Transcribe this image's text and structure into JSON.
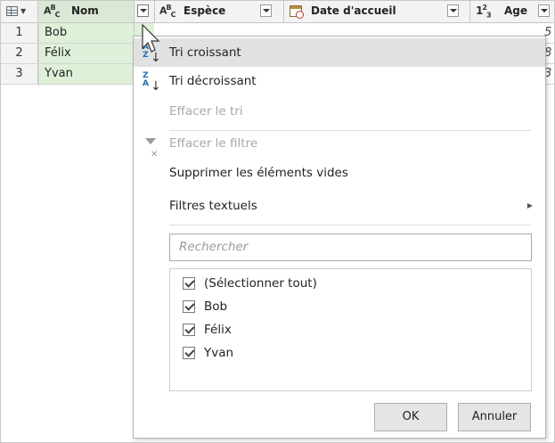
{
  "columns": [
    {
      "type_icon": "table-icon",
      "label": ""
    },
    {
      "type_icon": "abc-icon",
      "label": "Nom"
    },
    {
      "type_icon": "abc-icon",
      "label": "Espèce"
    },
    {
      "type_icon": "date-icon",
      "label": "Date d'accueil"
    },
    {
      "type_icon": "123-icon",
      "label": "Age"
    }
  ],
  "type_labels": {
    "abc_a": "A",
    "abc_b": "B",
    "abc_c": "C",
    "num_1": "1",
    "num_2": "2",
    "num_3": "3"
  },
  "rows": [
    {
      "num": "1",
      "nom": "Bob",
      "age_partial": "5"
    },
    {
      "num": "2",
      "nom": "Félix",
      "age_partial": "8"
    },
    {
      "num": "3",
      "nom": "Yvan",
      "age_partial": "3"
    }
  ],
  "menu": {
    "sort_asc": "Tri croissant",
    "sort_desc": "Tri décroissant",
    "clear_sort": "Effacer le tri",
    "clear_filter": "Effacer le filtre",
    "remove_empty": "Supprimer les éléments vides",
    "text_filters": "Filtres textuels",
    "search_placeholder": "Rechercher",
    "list": [
      {
        "label": "(Sélectionner tout)",
        "checked": true
      },
      {
        "label": "Bob",
        "checked": true
      },
      {
        "label": "Félix",
        "checked": true
      },
      {
        "label": "Yvan",
        "checked": true
      }
    ],
    "ok": "OK",
    "cancel": "Annuler"
  },
  "colors": {
    "accent_green": "#dff0d8",
    "highlight": "#e1e1e1",
    "disabled": "#a8a8a8"
  }
}
